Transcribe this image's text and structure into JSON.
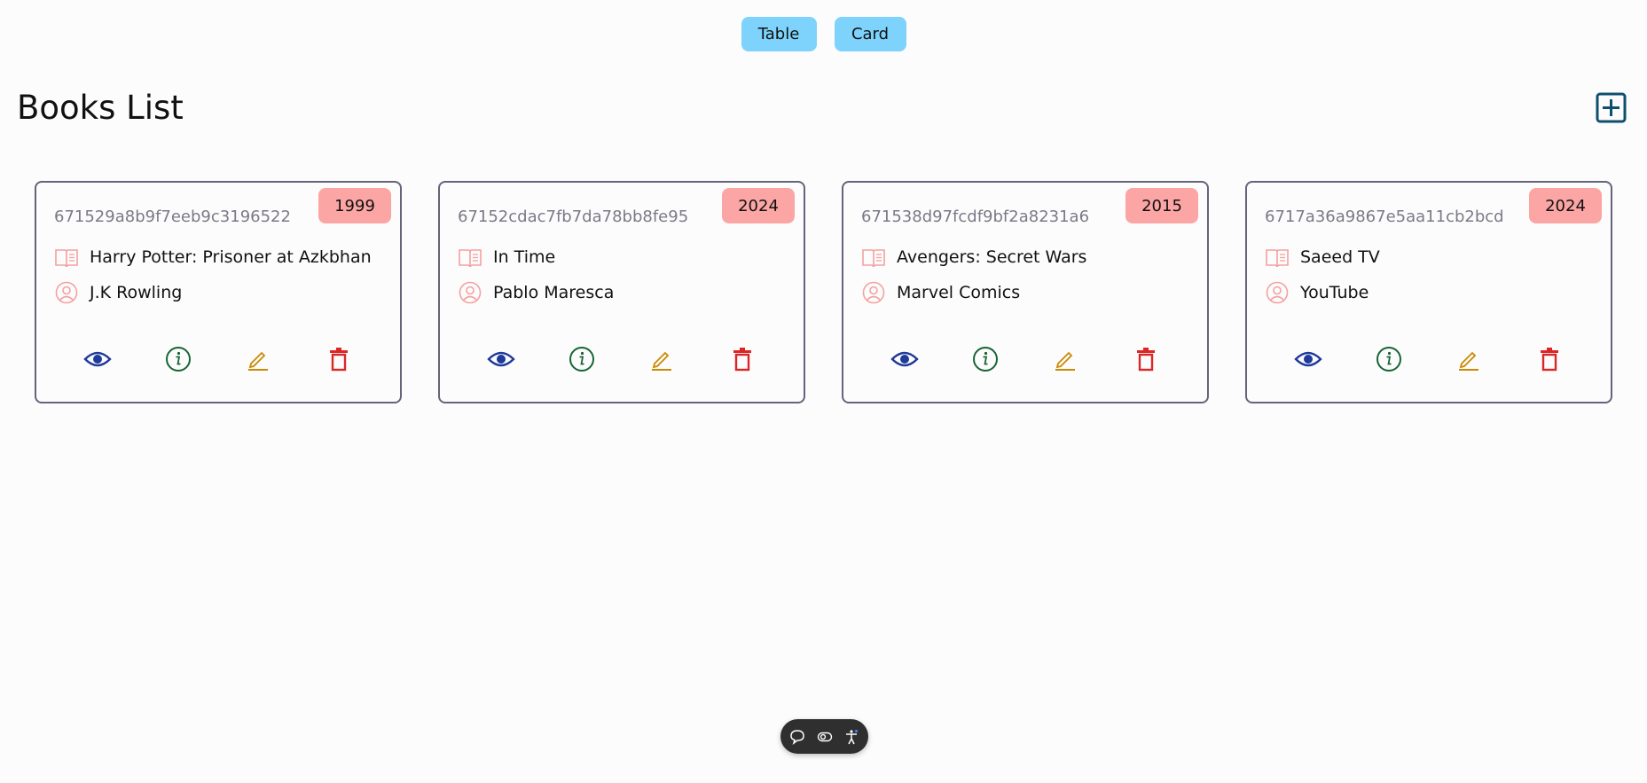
{
  "view_toggle": {
    "table_label": "Table",
    "card_label": "Card"
  },
  "page_title": "Books List",
  "books": [
    {
      "id": "671529a8b9f7eeb9c3196522",
      "year": "1999",
      "title": "Harry Potter: Prisoner at Azkbhan",
      "author": "J.K Rowling"
    },
    {
      "id": "67152cdac7fb7da78bb8fe95",
      "year": "2024",
      "title": "In Time",
      "author": "Pablo Maresca"
    },
    {
      "id": "671538d97fcdf9bf2a8231a6",
      "year": "2015",
      "title": "Avengers: Secret Wars",
      "author": "Marvel Comics"
    },
    {
      "id": "6717a36a9867e5aa11cb2bcd",
      "year": "2024",
      "title": "Saeed TV",
      "author": "YouTube"
    }
  ],
  "icons": {
    "add": "plus-square-icon",
    "book": "book-open-icon",
    "author": "user-circle-icon",
    "view": "eye-icon",
    "info": "info-circle-icon",
    "edit": "pencil-icon",
    "delete": "trash-icon",
    "toolbar": [
      "comment-icon",
      "eye-toggle-icon",
      "accessibility-icon"
    ]
  },
  "colors": {
    "toggle_bg": "#7dd3fc",
    "badge_bg": "#fca5a5",
    "icon_pink": "#f4a0a0",
    "view": "#1e3a9a",
    "info": "#166534",
    "edit": "#ca8a04",
    "delete": "#dc2626",
    "add": "#0e4f6e"
  }
}
